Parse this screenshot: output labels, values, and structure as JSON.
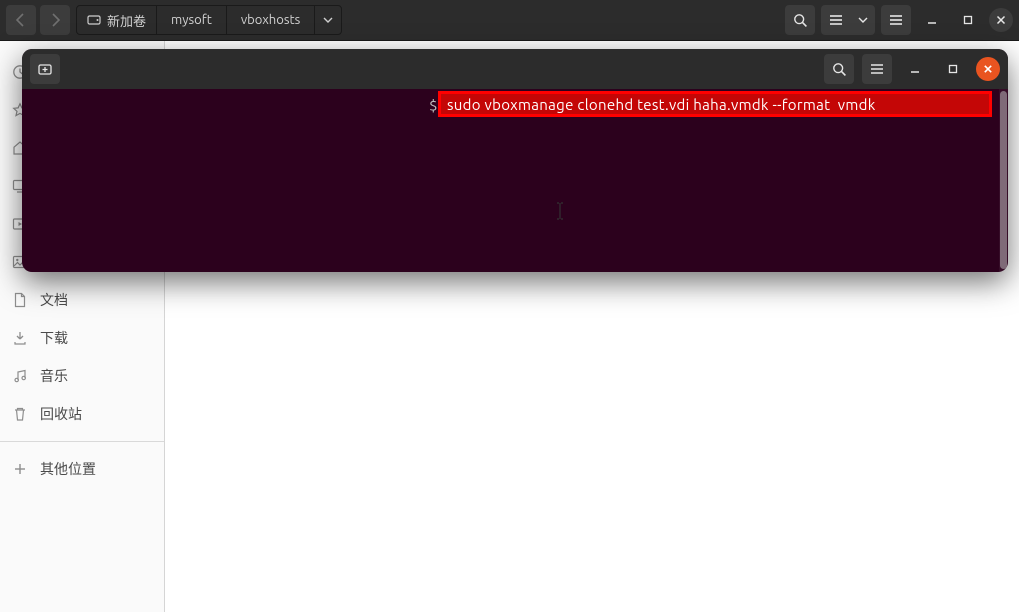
{
  "breadcrumb": [
    "新加卷",
    "mysoft",
    "vboxhosts"
  ],
  "sidebar": {
    "doc": "文档",
    "download": "下载",
    "music": "音乐",
    "trash": "回收站",
    "other": "其他位置"
  },
  "terminal": {
    "prompt": "$",
    "command": "sudo vboxmanage clonehd test.vdi haha.vmdk --format  vmdk"
  }
}
